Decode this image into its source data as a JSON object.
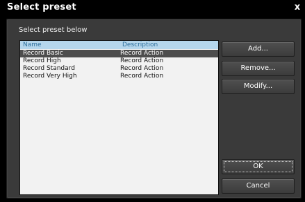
{
  "window": {
    "title": "Select preset",
    "close_symbol": "x"
  },
  "dialog": {
    "instructions": "Select preset below"
  },
  "list": {
    "columns": [
      "Name",
      "Description"
    ],
    "rows": [
      {
        "name": "Record Basic",
        "description": "Record Action",
        "selected": true
      },
      {
        "name": "Record High",
        "description": "Record Action",
        "selected": false
      },
      {
        "name": "Record Standard",
        "description": "Record Action",
        "selected": false
      },
      {
        "name": "Record Very High",
        "description": "Record Action",
        "selected": false
      }
    ]
  },
  "buttons": {
    "add": "Add...",
    "remove": "Remove...",
    "modify": "Modify...",
    "ok": "OK",
    "cancel": "Cancel"
  },
  "colors": {
    "title_background": "#000000",
    "panel_background": "#3a3a3a",
    "list_header_background": "#b5d6ec",
    "list_header_text": "#2d6f9c",
    "selected_row_background": "#4d4d4d"
  }
}
